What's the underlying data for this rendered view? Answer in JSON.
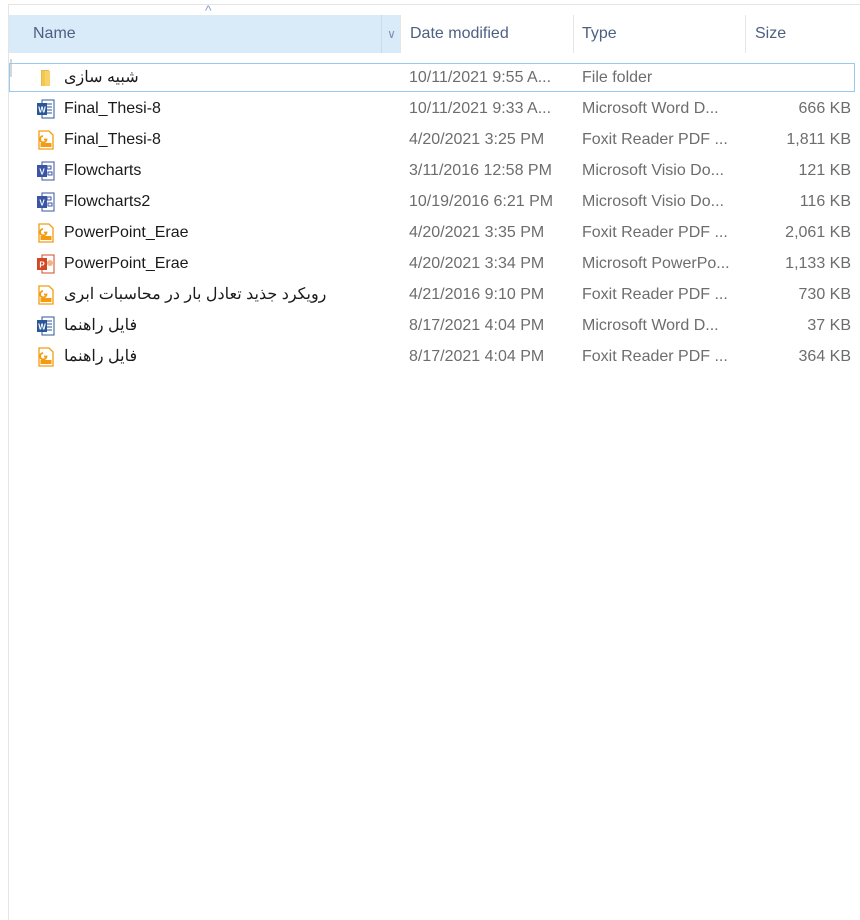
{
  "columns": {
    "name": "Name",
    "date": "Date modified",
    "type": "Type",
    "size": "Size"
  },
  "files": [
    {
      "name": "شبیه سازی",
      "date": "10/11/2021 9:55 A...",
      "type": "File folder",
      "size": "",
      "icon": "folder-icon",
      "selected": true
    },
    {
      "name": "Final_Thesi-8",
      "date": "10/11/2021 9:33 A...",
      "type": "Microsoft Word D...",
      "size": "666 KB",
      "icon": "word-icon"
    },
    {
      "name": "Final_Thesi-8",
      "date": "4/20/2021 3:25 PM",
      "type": "Foxit Reader PDF ...",
      "size": "1,811 KB",
      "icon": "pdf-icon"
    },
    {
      "name": "Flowcharts",
      "date": "3/11/2016 12:58 PM",
      "type": "Microsoft Visio Do...",
      "size": "121 KB",
      "icon": "visio-icon"
    },
    {
      "name": "Flowcharts2",
      "date": "10/19/2016 6:21 PM",
      "type": "Microsoft Visio Do...",
      "size": "116 KB",
      "icon": "visio-icon"
    },
    {
      "name": "PowerPoint_Erae",
      "date": "4/20/2021 3:35 PM",
      "type": "Foxit Reader PDF ...",
      "size": "2,061 KB",
      "icon": "pdf-icon"
    },
    {
      "name": "PowerPoint_Erae",
      "date": "4/20/2021 3:34 PM",
      "type": "Microsoft PowerPo...",
      "size": "1,133 KB",
      "icon": "powerpoint-icon"
    },
    {
      "name": "رویکرد جذید تعادل بار در محاسبات ابری",
      "date": "4/21/2016 9:10 PM",
      "type": "Foxit Reader PDF ...",
      "size": "730 KB",
      "icon": "pdf-icon"
    },
    {
      "name": "فایل راهنما",
      "date": "8/17/2021 4:04 PM",
      "type": "Microsoft Word D...",
      "size": "37 KB",
      "icon": "word-icon"
    },
    {
      "name": "فایل راهنما",
      "date": "8/17/2021 4:04 PM",
      "type": "Foxit Reader PDF ...",
      "size": "364 KB",
      "icon": "pdf-icon"
    }
  ],
  "colors": {
    "header_text": "#4d6082",
    "header_active_bg": "#d9ebf9",
    "selection_border": "#99c9ef",
    "word_blue": "#2b579a",
    "visio_blue": "#3955a3",
    "powerpoint_red": "#d24726",
    "pdf_orange": "#f39c12",
    "folder_yellow": "#f2c94c"
  }
}
